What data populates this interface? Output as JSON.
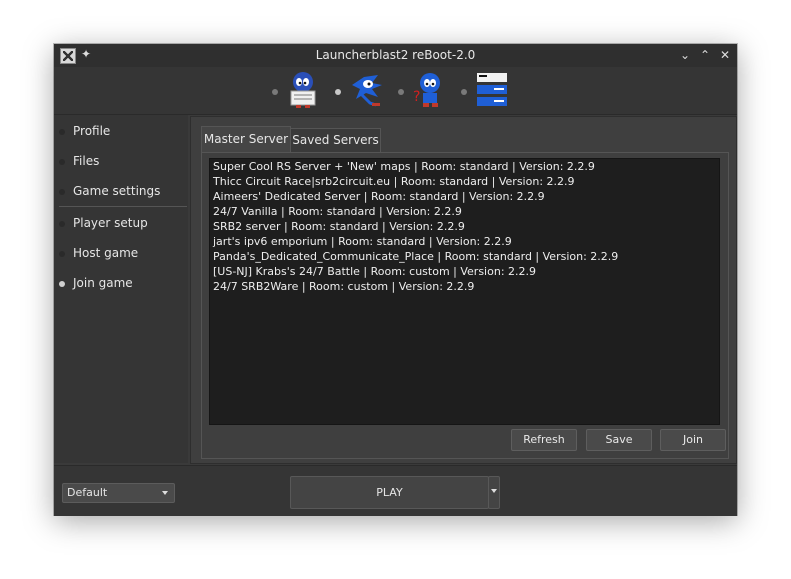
{
  "window": {
    "title": "Launcherblast2 reBoot-2.0",
    "icons": [
      "app-icon",
      "pin-icon",
      "minimize-icon",
      "maximize-icon",
      "close-icon"
    ]
  },
  "header": {
    "mascots": [
      "reading-mascot-icon",
      "running-mascot-icon",
      "thinking-mascot-icon",
      "server-list-icon"
    ]
  },
  "sidebar": {
    "items": [
      {
        "label": "Profile",
        "active": false
      },
      {
        "label": "Files",
        "active": false
      },
      {
        "label": "Game settings",
        "active": false
      },
      {
        "label": "Player setup",
        "active": false
      },
      {
        "label": "Host game",
        "active": false
      },
      {
        "label": "Join game",
        "active": true
      }
    ]
  },
  "main": {
    "tabs": [
      {
        "label": "Master Server",
        "active": true
      },
      {
        "label": "Saved Servers",
        "active": false
      }
    ],
    "servers": [
      "Super Cool RS Server + 'New' maps | Room: standard | Version: 2.2.9",
      "Thicc Circuit Race|srb2circuit.eu | Room: standard | Version: 2.2.9",
      "Aimeers' Dedicated Server | Room: standard | Version: 2.2.9",
      "24/7 Vanilla | Room: standard | Version: 2.2.9",
      "SRB2 server | Room: standard | Version: 2.2.9",
      "jart's ipv6 emporium | Room: standard | Version: 2.2.9",
      "Panda's_Dedicated_Communicate_Place | Room: standard | Version: 2.2.9",
      "[US-NJ] Krabs's 24/7 Battle | Room: custom | Version: 2.2.9",
      "24/7 SRB2Ware | Room: custom | Version: 2.2.9"
    ],
    "buttons": {
      "refresh": "Refresh",
      "save": "Save",
      "join": "Join"
    }
  },
  "footer": {
    "profile_select": "Default",
    "play": "PLAY"
  },
  "colors": {
    "window_bg": "#3a3a3a",
    "list_bg": "#1e1e1e",
    "accent_blue": "#1f5fd6"
  }
}
